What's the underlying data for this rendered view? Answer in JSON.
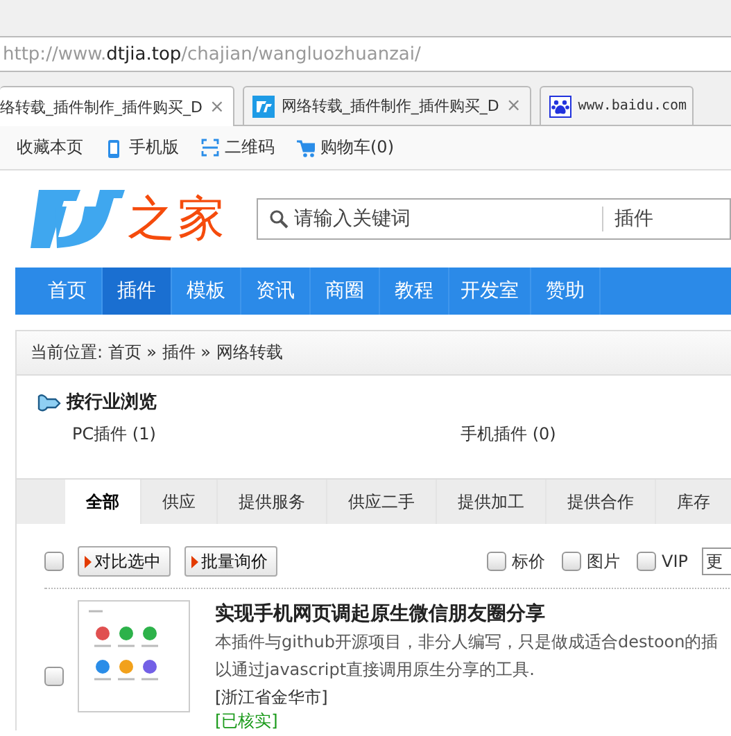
{
  "address_bar": {
    "url_scheme": "http://www.",
    "url_domain": "dtjia.top",
    "url_path": "/chajian/wangluozhuanzai/"
  },
  "browser_tabs": [
    {
      "title": "络转载_插件制作_插件购买_D",
      "close": "×",
      "selected": true
    },
    {
      "title": "网络转载_插件制作_插件购买_D",
      "close": "×",
      "selected": false
    },
    {
      "title": "www.baidu.com",
      "selected": false
    }
  ],
  "toolbar": [
    {
      "label": "收藏本页"
    },
    {
      "label": "手机版"
    },
    {
      "label": "二维码"
    },
    {
      "label": "购物车(0)"
    }
  ],
  "logo": {
    "text": "之家"
  },
  "search": {
    "placeholder": "请输入关键词",
    "scope": "插件"
  },
  "nav": [
    {
      "label": "首页",
      "selected": false
    },
    {
      "label": "插件",
      "selected": true
    },
    {
      "label": "模板",
      "selected": false
    },
    {
      "label": "资讯",
      "selected": false
    },
    {
      "label": "商圈",
      "selected": false
    },
    {
      "label": "教程",
      "selected": false
    },
    {
      "label": "开发室",
      "selected": false
    },
    {
      "label": "赞助",
      "selected": false
    }
  ],
  "breadcrumb": "当前位置: 首页 » 插件 » 网络转载",
  "category": {
    "title": "按行业浏览",
    "items": [
      "PC插件 (1)",
      "手机插件 (0)"
    ]
  },
  "filter_tabs": [
    {
      "label": "全部",
      "selected": true
    },
    {
      "label": "供应",
      "selected": false
    },
    {
      "label": "提供服务",
      "selected": false
    },
    {
      "label": "供应二手",
      "selected": false
    },
    {
      "label": "提供加工",
      "selected": false
    },
    {
      "label": "提供合作",
      "selected": false
    },
    {
      "label": "库存",
      "selected": false
    }
  ],
  "actions": {
    "select_all_checked": false,
    "buttons": [
      "对比选中",
      "批量询价"
    ],
    "filters": [
      {
        "label": "标价",
        "checked": false
      },
      {
        "label": "图片",
        "checked": false
      },
      {
        "label": "VIP",
        "checked": false
      }
    ],
    "sort": "更"
  },
  "listings": [
    {
      "checked": false,
      "title": "实现手机网页调起原生微信朋友圈分享",
      "description_lines": [
        "本插件与github开源项目，非分人编写，只是做成适合destoon的插",
        "以通过javascript直接调用原生分享的工具."
      ],
      "location": "[浙江省金华市]",
      "verified": "[已核实]"
    }
  ]
}
